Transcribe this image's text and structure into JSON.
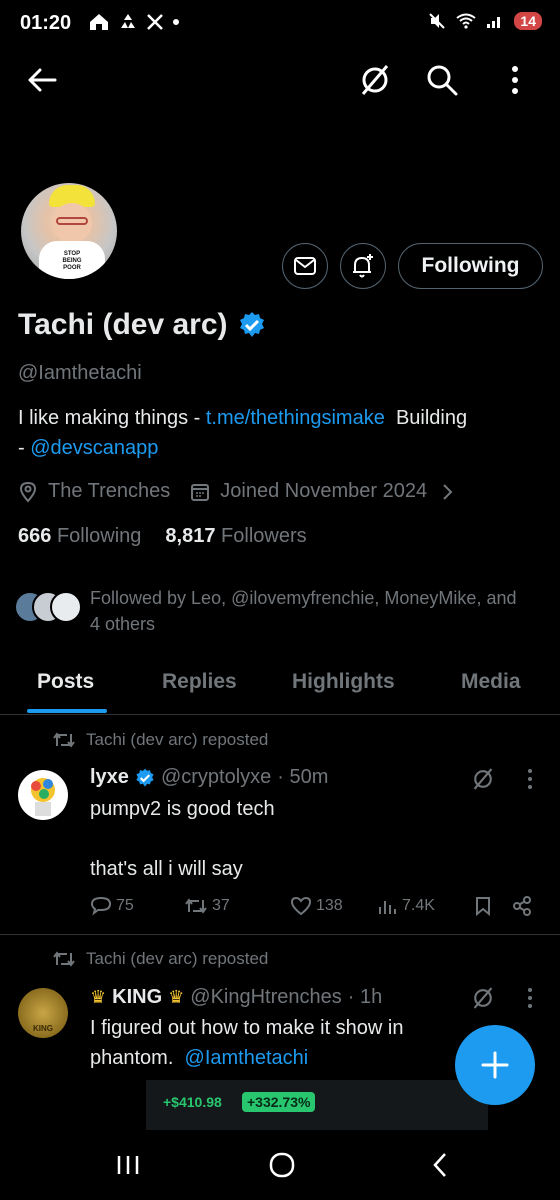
{
  "status_bar": {
    "time": "01:20",
    "battery": "14"
  },
  "profile": {
    "name": "Tachi (dev arc)",
    "handle": "@Iamthetachi",
    "bio_text": "I like making things - ",
    "bio_link": "t.me/thethingsimake",
    "bio_after": "  Building",
    "bio_line2_prefix": "- ",
    "bio_mention": "@devscanapp",
    "location": "The Trenches",
    "joined": "Joined November 2024",
    "following_count": "666",
    "following_label": "Following",
    "followers_count": "8,817",
    "followers_label": "Followers",
    "followed_by": "Followed by Leo, @ilovemyfrenchie, MoneyMike, and 4 others",
    "follow_button": "Following",
    "avatar_text": "STOP BEING POOR"
  },
  "tabs": [
    "Posts",
    "Replies",
    "Highlights",
    "Media"
  ],
  "posts": [
    {
      "repost_label": "Tachi (dev arc) reposted",
      "author": "lyxe",
      "handle": "@cryptolyxe",
      "time": "· 50m",
      "line1": "pumpv2 is good tech",
      "line2": "that's all i will say",
      "replies": "75",
      "reposts": "37",
      "likes": "138",
      "views": "7.4K"
    },
    {
      "repost_label": "Tachi (dev arc) reposted",
      "author": "KING",
      "handle": "@KingHtrenches",
      "time": "· 1h",
      "line1": "I figured out how to make it show in",
      "line2_prefix": "phantom.  ",
      "mention": "@Iamthetachi",
      "embed_value": "+$410.98",
      "embed_pct": "+332.73%",
      "avatar_text": "KING"
    }
  ],
  "colors": {
    "accent": "#1d9bf0",
    "muted": "#71767b",
    "text": "#e7e9ea",
    "positive": "#28c76f"
  }
}
